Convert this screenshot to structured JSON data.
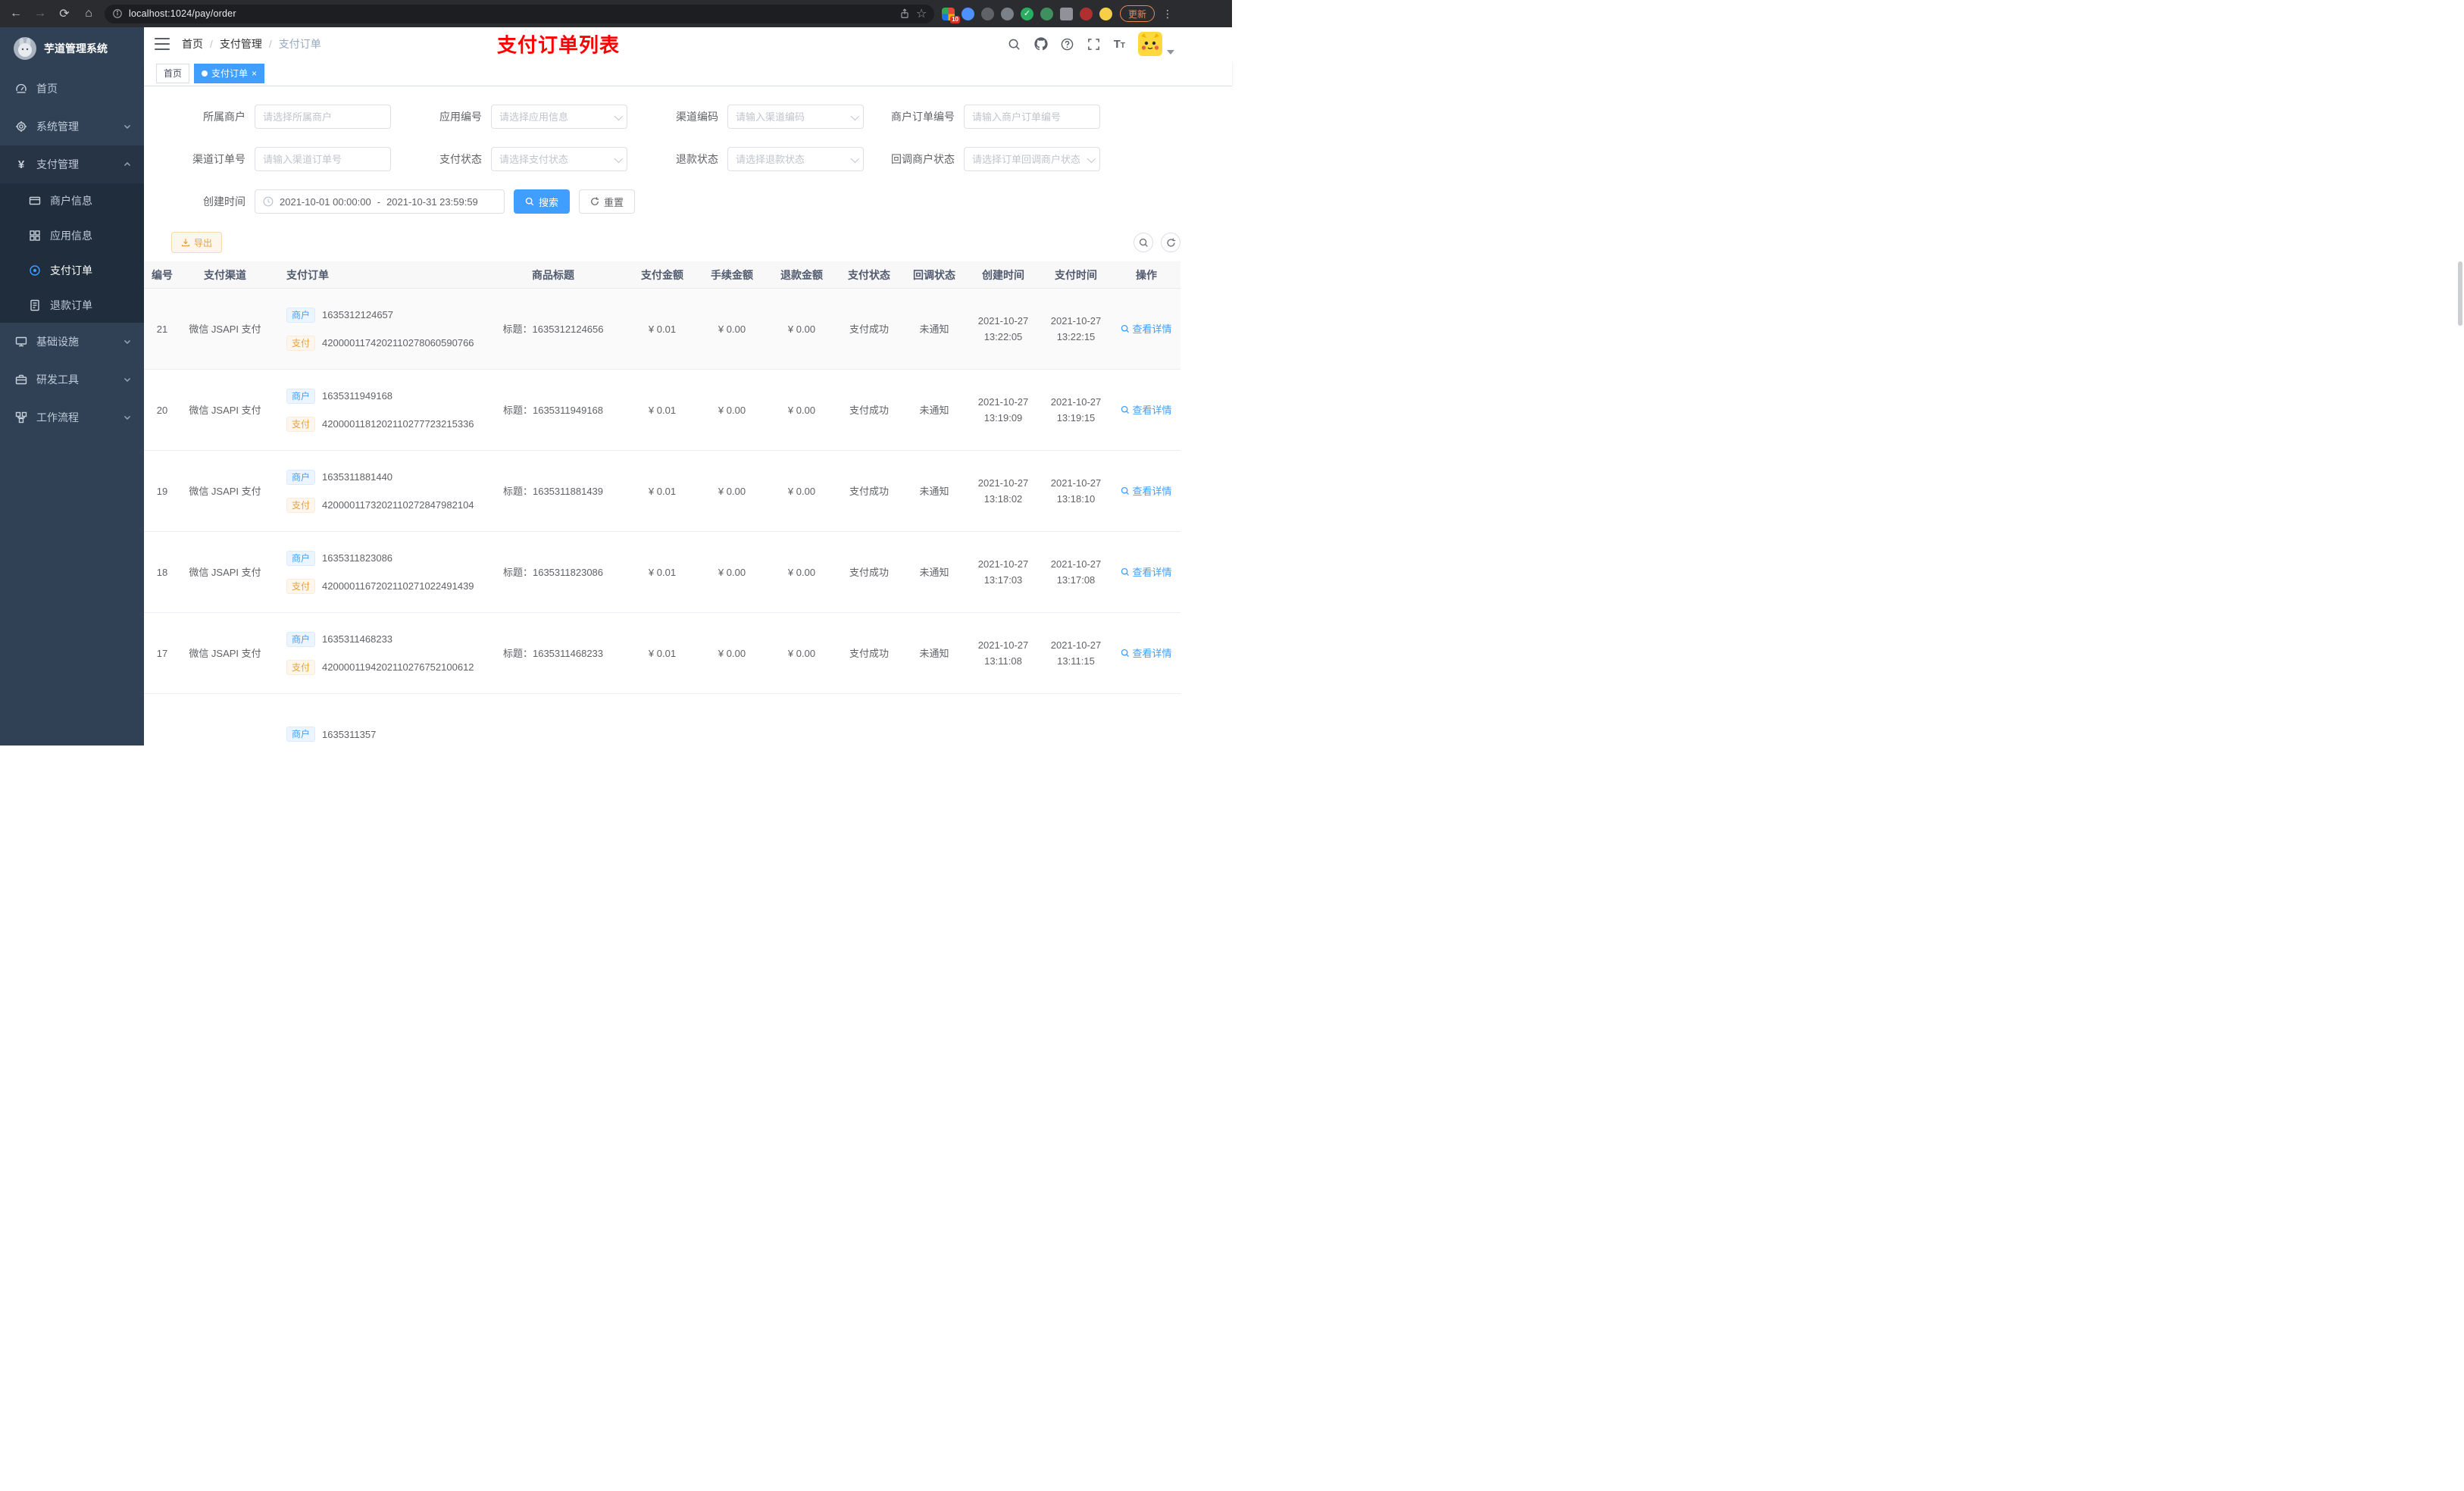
{
  "colors": {
    "accent": "#409eff",
    "warning": "#e6a23c",
    "title_red": "#ff0000",
    "sidebar_bg": "#304156",
    "submenu_bg": "#1f2d3d"
  },
  "icons": {
    "back": "←",
    "forward": "→",
    "reload": "⟳",
    "home": "⌂",
    "star": "☆",
    "kebab": "⋮",
    "close": "×",
    "pay_currency": "¥"
  },
  "browser": {
    "url": "localhost:1024/pay/order",
    "extension_badge": "10",
    "update_label": "更新"
  },
  "sidebar": {
    "title": "芋道管理系统",
    "items": [
      {
        "label": "首页"
      },
      {
        "label": "系统管理"
      },
      {
        "label": "支付管理"
      },
      {
        "label": "商户信息"
      },
      {
        "label": "应用信息"
      },
      {
        "label": "支付订单"
      },
      {
        "label": "退款订单"
      },
      {
        "label": "基础设施"
      },
      {
        "label": "研发工具"
      },
      {
        "label": "工作流程"
      }
    ]
  },
  "navbar": {
    "breadcrumb": [
      "首页",
      "支付管理",
      "支付订单"
    ],
    "separator": "/",
    "page_title": "支付订单列表"
  },
  "tags": [
    {
      "label": "首页",
      "active": false
    },
    {
      "label": "支付订单",
      "active": true
    }
  ],
  "filters": {
    "items": [
      {
        "label": "所属商户",
        "placeholder": "请选择所属商户"
      },
      {
        "label": "应用编号",
        "placeholder": "请选择应用信息"
      },
      {
        "label": "渠道编码",
        "placeholder": "请输入渠道编码"
      },
      {
        "label": "商户订单编号",
        "placeholder": "请输入商户订单编号"
      },
      {
        "label": "渠道订单号",
        "placeholder": "请输入渠道订单号"
      },
      {
        "label": "支付状态",
        "placeholder": "请选择支付状态"
      },
      {
        "label": "退款状态",
        "placeholder": "请选择退款状态"
      },
      {
        "label": "回调商户状态",
        "placeholder": "请选择订单回调商户状态"
      }
    ],
    "create_time": {
      "label": "创建时间",
      "start": "2021-10-01 00:00:00",
      "separator": "-",
      "end": "2021-10-31 23:59:59"
    },
    "search_label": "搜索",
    "reset_label": "重置"
  },
  "toolbar": {
    "export_label": "导出"
  },
  "table": {
    "headers": [
      "编号",
      "支付渠道",
      "支付订单",
      "商品标题",
      "支付金额",
      "手续金额",
      "退款金额",
      "支付状态",
      "回调状态",
      "创建时间",
      "支付时间",
      "操作"
    ],
    "merchant_tag": "商户",
    "pay_tag": "支付",
    "rows": [
      {
        "id": "21",
        "channel": "微信 JSAPI 支付",
        "merchant_no": "1635312124657",
        "pay_no": "4200001174202110278060590766",
        "title": "标题：1635312124656",
        "amount": "¥ 0.01",
        "fee": "¥ 0.00",
        "refund": "¥ 0.00",
        "status": "支付成功",
        "notify": "未通知",
        "create_date": "2021-10-27",
        "create_time": "13:22:05",
        "pay_date": "2021-10-27",
        "pay_time": "13:22:15",
        "action": "查看详情"
      },
      {
        "id": "20",
        "channel": "微信 JSAPI 支付",
        "merchant_no": "1635311949168",
        "pay_no": "4200001181202110277723215336",
        "title": "标题：1635311949168",
        "amount": "¥ 0.01",
        "fee": "¥ 0.00",
        "refund": "¥ 0.00",
        "status": "支付成功",
        "notify": "未通知",
        "create_date": "2021-10-27",
        "create_time": "13:19:09",
        "pay_date": "2021-10-27",
        "pay_time": "13:19:15",
        "action": "查看详情"
      },
      {
        "id": "19",
        "channel": "微信 JSAPI 支付",
        "merchant_no": "1635311881440",
        "pay_no": "4200001173202110272847982104",
        "title": "标题：1635311881439",
        "amount": "¥ 0.01",
        "fee": "¥ 0.00",
        "refund": "¥ 0.00",
        "status": "支付成功",
        "notify": "未通知",
        "create_date": "2021-10-27",
        "create_time": "13:18:02",
        "pay_date": "2021-10-27",
        "pay_time": "13:18:10",
        "action": "查看详情"
      },
      {
        "id": "18",
        "channel": "微信 JSAPI 支付",
        "merchant_no": "1635311823086",
        "pay_no": "4200001167202110271022491439",
        "title": "标题：1635311823086",
        "amount": "¥ 0.01",
        "fee": "¥ 0.00",
        "refund": "¥ 0.00",
        "status": "支付成功",
        "notify": "未通知",
        "create_date": "2021-10-27",
        "create_time": "13:17:03",
        "pay_date": "2021-10-27",
        "pay_time": "13:17:08",
        "action": "查看详情"
      },
      {
        "id": "17",
        "channel": "微信 JSAPI 支付",
        "merchant_no": "1635311468233",
        "pay_no": "4200001194202110276752100612",
        "title": "标题：1635311468233",
        "amount": "¥ 0.01",
        "fee": "¥ 0.00",
        "refund": "¥ 0.00",
        "status": "支付成功",
        "notify": "未通知",
        "create_date": "2021-10-27",
        "create_time": "13:11:08",
        "pay_date": "2021-10-27",
        "pay_time": "13:11:15",
        "action": "查看详情"
      },
      {
        "id": "",
        "channel": "",
        "merchant_no": "1635311357",
        "pay_no": "",
        "title": "",
        "amount": "",
        "fee": "",
        "refund": "",
        "status": "",
        "notify": "",
        "create_date": "",
        "create_time": "",
        "pay_date": "",
        "pay_time": "",
        "action": ""
      }
    ]
  }
}
